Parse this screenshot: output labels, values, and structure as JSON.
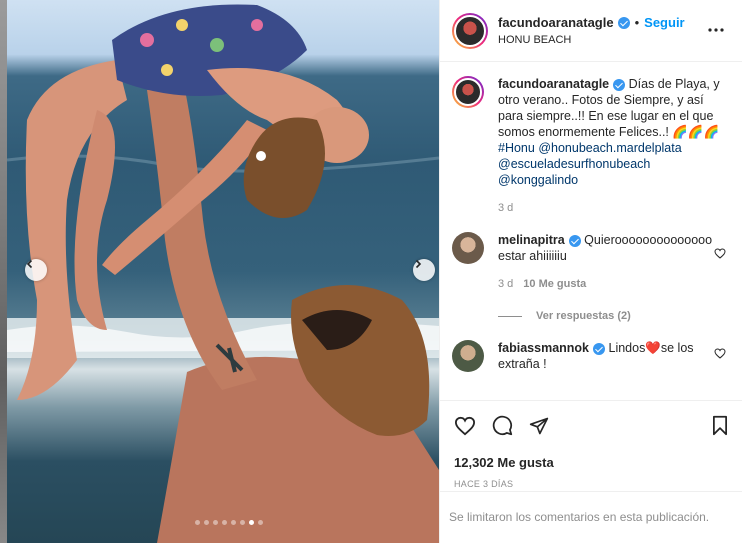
{
  "post": {
    "author": "facundoaranatagle",
    "follow_label": "Seguir",
    "separator": "•",
    "location": "HONU BEACH",
    "more_icon": "more-horizontal-icon",
    "media": {
      "carousel_dots": 8,
      "active_dot_index": 6,
      "prev_icon": "chevron-left-icon",
      "next_icon": "chevron-right-icon"
    }
  },
  "caption": {
    "username": "facundoaranatagle",
    "text": " Días de Playa, y otro verano.. Fotos de Siempre, y así para siempre..!! En ese lugar en el que somos enormemente Felices..! 🌈🌈🌈",
    "hashtag": "#Honu",
    "mentions": [
      "@honubeach.mardelplata",
      "@escueladesurfhonubeach",
      "@konggalindo"
    ],
    "time": "3 d"
  },
  "comments": [
    {
      "username": "melinapitra",
      "text": " Quieroooooooooooooo estar ahiiiiiiu",
      "time": "3 d",
      "likes": "10 Me gusta",
      "replies_label": "Ver respuestas (2)"
    },
    {
      "username": "fabiassmannok",
      "text": " Lindos❤️se los extraña !"
    }
  ],
  "actions": {
    "icons": [
      "heart-icon",
      "comment-icon",
      "share-icon",
      "bookmark-icon"
    ],
    "likes_count": "12,302 Me gusta",
    "posted_ago": "HACE 3 DÍAS",
    "comments_limited": "Se limitaron los comentarios en esta publicación."
  },
  "colors": {
    "link": "#0095f6",
    "mention": "#00376b",
    "verified": "#3897f0",
    "muted": "#8e8e8e"
  }
}
